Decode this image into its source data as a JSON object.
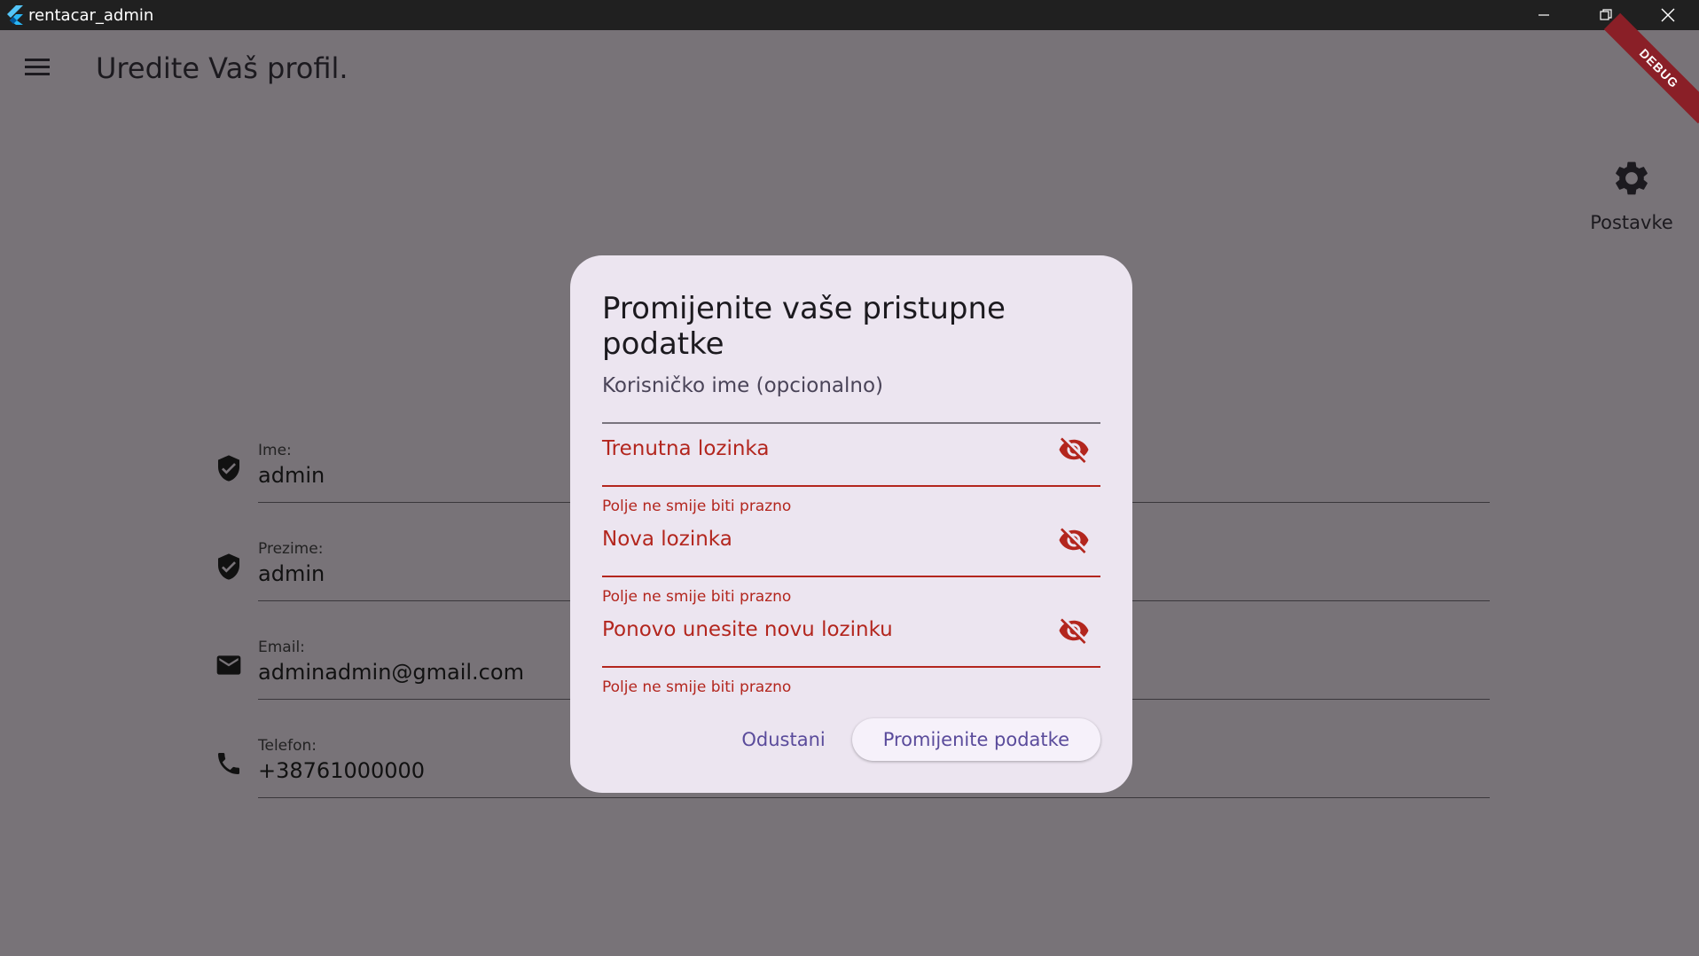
{
  "window": {
    "title": "rentacar_admin"
  },
  "appbar": {
    "title": "Uredite Vaš profil."
  },
  "debug_banner": "DEBUG",
  "settings": {
    "label": "Postavke",
    "icon": "gear-icon"
  },
  "profile": {
    "fields": [
      {
        "label": "Ime:",
        "value": "admin",
        "icon": "verified-shield-icon"
      },
      {
        "label": "Prezime:",
        "value": "admin",
        "icon": "verified-shield-icon"
      },
      {
        "label": "Email:",
        "value": "adminadmin@gmail.com",
        "icon": "mail-icon"
      },
      {
        "label": "Telefon:",
        "value": "+38761000000",
        "icon": "phone-icon"
      }
    ]
  },
  "dialog": {
    "title": "Promijenite vaše pristupne podatke",
    "username_placeholder": "Korisničko ime (opcionalno)",
    "current_password_placeholder": "Trenutna lozinka",
    "new_password_placeholder": "Nova lozinka",
    "repeat_password_placeholder": "Ponovo unesite novu lozinku",
    "error_text": "Polje ne smije biti prazno",
    "cancel_label": "Odustani",
    "submit_label": "Promijenite podatke"
  },
  "colors": {
    "error": "#b3261e",
    "accent": "#5a4b9b",
    "dialog_bg": "#ece5f0",
    "barrier": "#787378"
  }
}
